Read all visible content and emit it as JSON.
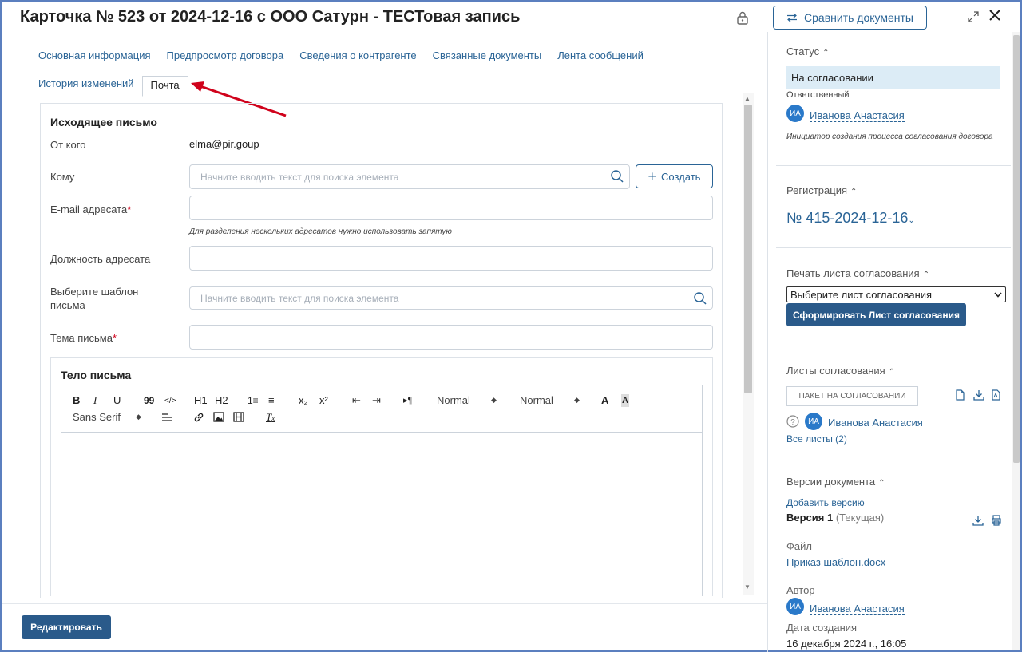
{
  "header": {
    "title": "Карточка № 523 от 2024-12-16 с ООО Сатурн - ТЕСТовая запись",
    "compare_label": "Сравнить документы",
    "compare_icon": "swap-arrows-icon"
  },
  "tabs": {
    "row1": [
      "Основная информация",
      "Предпросмотр договора",
      "Сведения о контрагенте",
      "Связанные документы",
      "Лента сообщений"
    ],
    "row2": [
      "История изменений"
    ],
    "active": "Почта"
  },
  "form": {
    "section_title": "Исходящее письмо",
    "from_label": "От кого",
    "from_value": "elma@pir.goup",
    "to_label": "Кому",
    "to_placeholder": "Начните вводить текст для поиска элемента",
    "create_label": "Создать",
    "email_label": "E-mail адресата",
    "email_hint": "Для разделения нескольких адресатов нужно использовать запятую",
    "position_label": "Должность адресата",
    "template_label": "Выберите шаблон письма",
    "template_placeholder": "Начните вводить текст для поиска элемента",
    "subject_label": "Тема письма",
    "required_mark": "*",
    "body_title": "Тело письма"
  },
  "editor_toolbar": {
    "bold": "B",
    "italic": "I",
    "underline": "U",
    "quote": "99",
    "code": "</>",
    "h1": "H1",
    "h2": "H2",
    "list_ordered": "1≡",
    "list_bullet": "≡",
    "sub": "x₂",
    "sup": "x²",
    "outdent": "⇤",
    "indent": "⇥",
    "rtl": "▸¶",
    "size_value": "Normal",
    "header_value": "Normal",
    "font_value": "Sans Serif"
  },
  "footer": {
    "edit_label": "Редактировать"
  },
  "sidebar": {
    "status_heading": "Статус",
    "status_value": "На согласовании",
    "responsible_label": "Ответственный",
    "responsible_initials": "ИА",
    "responsible_name": "Иванова Анастасия",
    "responsible_role": "Инициатор создания процесса согласования договора",
    "registration_heading": "Регистрация",
    "registration_number": "№ 415-2024-12-16",
    "print_heading": "Печать листа согласования",
    "print_select": "Выберите лист согласования",
    "print_button": "Сформировать Лист согласования",
    "sheets_heading": "Листы согласования",
    "sheets_package": "ПАКЕТ НА СОГЛАСОВАНИИ",
    "sheets_initials": "ИА",
    "sheets_person": "Иванова Анастасия",
    "sheets_all": "Все листы (2)",
    "versions_heading": "Версии документа",
    "add_version": "Добавить версию",
    "version_label": "Версия 1",
    "version_current": "(Текущая)",
    "file_label": "Файл",
    "file_name": "Приказ шаблон.docx",
    "author_label": "Автор",
    "author_initials": "ИА",
    "author_name": "Иванова Анастасия",
    "created_label": "Дата создания",
    "created_value": "16 декабря 2024 г., 16:05"
  },
  "colors": {
    "accent": "#2a6496",
    "button": "#2a5a8a",
    "status_bg": "#dcecf6",
    "arrow": "#d0021b"
  }
}
